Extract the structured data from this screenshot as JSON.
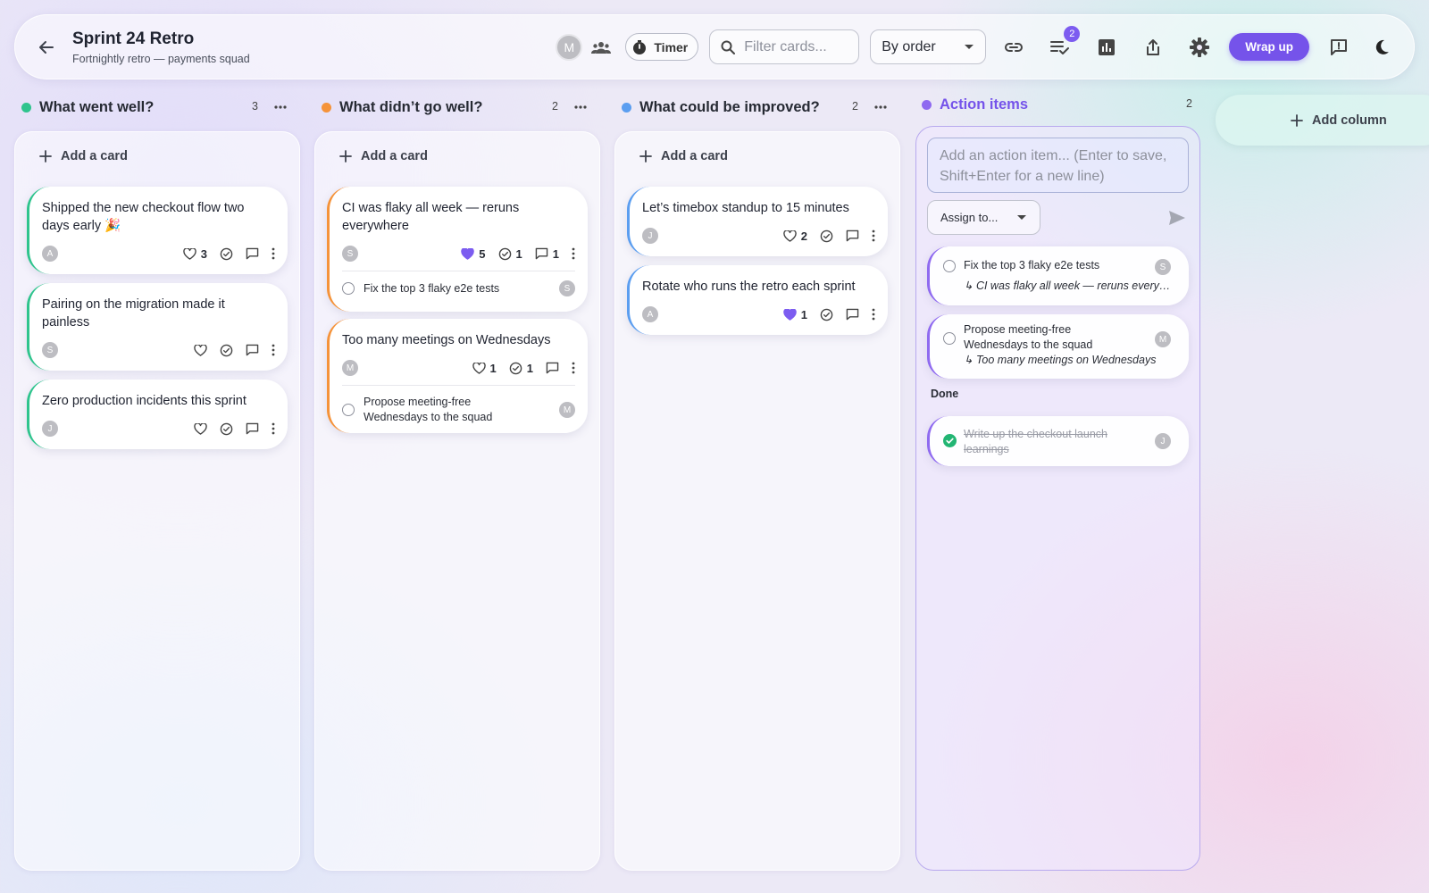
{
  "header": {
    "title": "Sprint 24 Retro",
    "subtitle": "Fortnightly retro — payments squad",
    "user_initial": "M",
    "timer_label": "Timer",
    "search_placeholder": "Filter cards...",
    "sort_value": "By order",
    "actions_badge": "2",
    "wrap_up_label": "Wrap up"
  },
  "add_card_label": "Add a card",
  "columns": [
    {
      "name": "What went well?",
      "count": "3",
      "color": "#2fc48d",
      "cards": [
        {
          "text": "Shipped the new checkout flow two days early 🎉",
          "author": "A",
          "likes": "3",
          "liked": false
        },
        {
          "text": "Pairing on the migration made it painless",
          "author": "S",
          "likes": "",
          "liked": false
        },
        {
          "text": "Zero production incidents this sprint",
          "author": "J",
          "likes": "",
          "liked": false
        }
      ]
    },
    {
      "name": "What didn’t go well?",
      "count": "2",
      "color": "#f5933a",
      "cards": [
        {
          "text": "CI was flaky all week — reruns everywhere",
          "author": "S",
          "likes": "5",
          "liked": true,
          "checks": "1",
          "comments": "1",
          "action": {
            "text": "Fix the top 3 flaky e2e tests",
            "assignee": "S"
          }
        },
        {
          "text": "Too many meetings on Wednesdays",
          "author": "M",
          "likes": "1",
          "liked": false,
          "checks": "1",
          "action": {
            "text": "Propose meeting-free Wednesdays to the squad",
            "assignee": "M"
          }
        }
      ]
    },
    {
      "name": "What could be improved?",
      "count": "2",
      "color": "#5b9ef0",
      "cards": [
        {
          "text": "Let’s timebox standup to 15 minutes",
          "author": "J",
          "likes": "2",
          "liked": false
        },
        {
          "text": "Rotate who runs the retro each sprint",
          "author": "A",
          "likes": "1",
          "liked": true
        }
      ]
    }
  ],
  "action_items": {
    "title": "Action items",
    "count": "2",
    "color": "#8f6af0",
    "input_placeholder": "Add an action item... (Enter to save, Shift+Enter for a new line)",
    "assign_label": "Assign to...",
    "open": [
      {
        "text": "Fix the top 3 flaky e2e tests",
        "link": "↳ CI was flaky all week — reruns everywhere",
        "assignee": "S"
      },
      {
        "text": "Propose meeting-free Wednesdays to the squad",
        "link": "↳ Too many meetings on Wednesdays",
        "assignee": "M"
      }
    ],
    "done_label": "Done",
    "done": [
      {
        "text": "Write up the checkout launch learnings",
        "assignee": "J"
      }
    ]
  },
  "add_column_label": "Add column",
  "colors": {
    "accent": "#7553ea",
    "liked_heart": "#7c5cf0",
    "done_check": "#22b573"
  }
}
